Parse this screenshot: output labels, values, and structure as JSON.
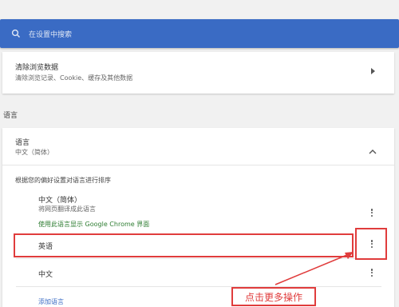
{
  "search": {
    "placeholder": "在设置中搜索"
  },
  "clear_data": {
    "title": "清除浏览数据",
    "subtitle": "清除浏览记录、Cookie、缓存及其他数据"
  },
  "section": {
    "label": "语言"
  },
  "languages": {
    "title": "语言",
    "current": "中文（简体）",
    "order_hint": "根据您的偏好设置对语言进行排序",
    "items": [
      {
        "name": "中文（简体）",
        "note": "将网页翻译成此语言",
        "display_note": "使用此语言显示 Google Chrome 界面"
      },
      {
        "name": "英语"
      },
      {
        "name": "中文"
      }
    ],
    "add_label": "添加语言"
  },
  "annotation": {
    "callout": "点击更多操作"
  },
  "colors": {
    "accent": "#3a6bc4",
    "highlight": "#e03c3c",
    "green": "#2e7d32"
  }
}
